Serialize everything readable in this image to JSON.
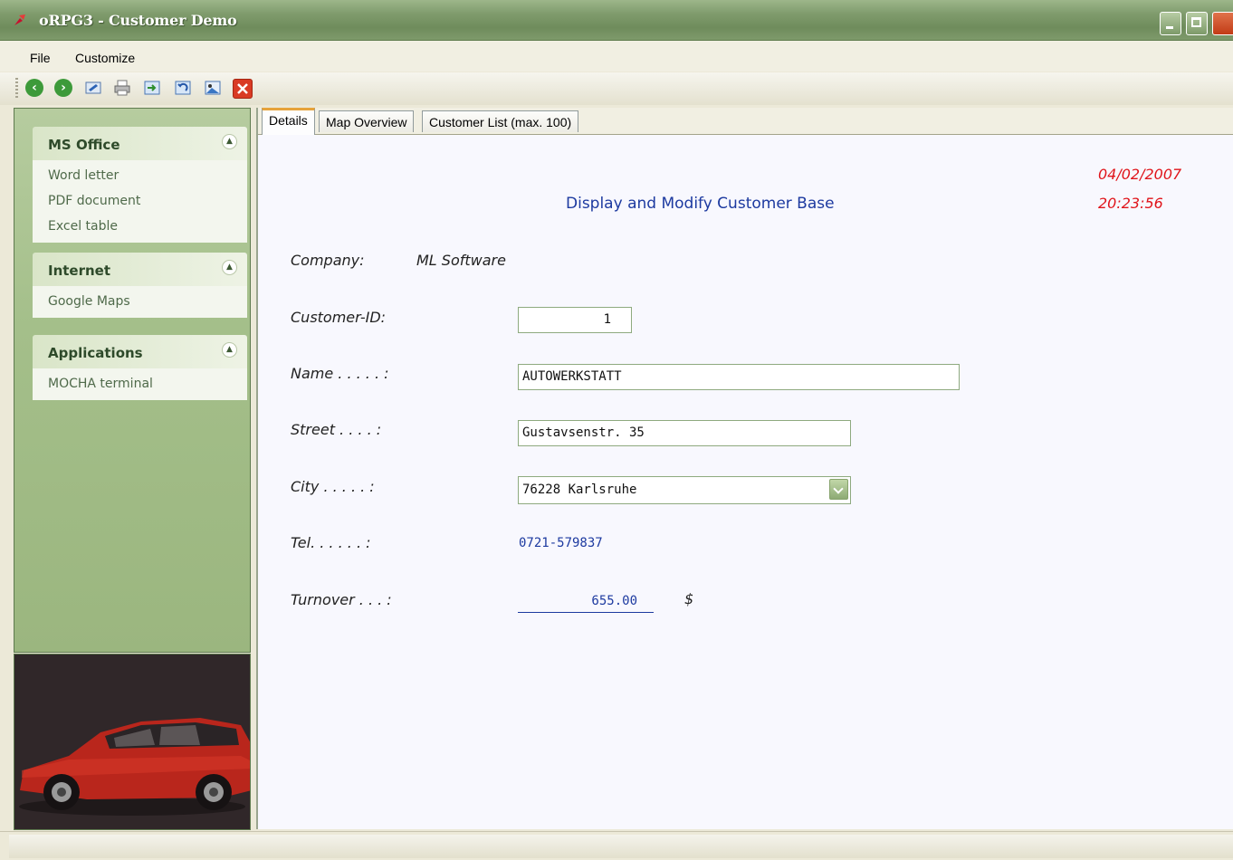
{
  "window": {
    "title": "oRPG3 - Customer Demo"
  },
  "menu": [
    "File",
    "Customize"
  ],
  "toolbar": {
    "buttons": [
      "back-icon",
      "forward-icon",
      "edit-icon",
      "print-icon",
      "export-icon",
      "undo-icon",
      "image-icon",
      "close-icon"
    ]
  },
  "sidebar": {
    "groups": [
      {
        "title": "MS Office",
        "items": [
          "Word letter",
          "PDF document",
          "Excel table"
        ]
      },
      {
        "title": "Internet",
        "items": [
          "Google Maps"
        ]
      },
      {
        "title": "Applications",
        "items": [
          "MOCHA terminal"
        ]
      }
    ]
  },
  "tabs": [
    "Details",
    "Map Overview",
    "Customer List (max. 100)"
  ],
  "form": {
    "heading": "Display and Modify Customer Base",
    "date": "04/02/2007",
    "time": "20:23:56",
    "company_label": "Company:",
    "company_value": "ML Software",
    "customer_id_label": "Customer-ID:",
    "customer_id_value": "1",
    "name_label": "Name . . . . . :",
    "name_value": "AUTOWERKSTATT",
    "street_label": "Street . . . . :",
    "street_value": "Gustavsenstr. 35",
    "city_label": "City . . . . . :",
    "city_value": "76228 Karlsruhe",
    "tel_label": "Tel. . . . . . :",
    "tel_value": "0721-579837",
    "turnover_label": "Turnover . . . :",
    "turnover_value": "655.00",
    "currency": "$"
  },
  "colors": {
    "accent_green": "#a4bf8a",
    "date_red": "#e0151b",
    "value_blue": "#1d3aa0"
  }
}
